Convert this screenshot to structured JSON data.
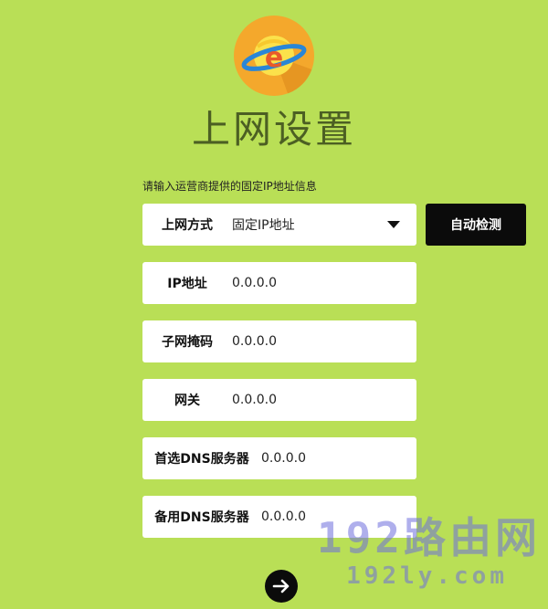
{
  "header": {
    "logo_icon": "ie-planet-icon",
    "title": "上网设置"
  },
  "form": {
    "hint": "请输入运营商提供的固定IP地址信息",
    "connection_type": {
      "label": "上网方式",
      "value": "固定IP地址"
    },
    "ip_address": {
      "label": "IP地址",
      "value": "0.0.0.0"
    },
    "subnet_mask": {
      "label": "子网掩码",
      "value": "0.0.0.0"
    },
    "gateway": {
      "label": "网关",
      "value": "0.0.0.0"
    },
    "primary_dns": {
      "label": "首选DNS服务器",
      "value": "0.0.0.0"
    },
    "secondary_dns": {
      "label": "备用DNS服务器",
      "value": "0.0.0.0"
    }
  },
  "buttons": {
    "auto_detect": "自动检测",
    "next_icon": "arrow-right-icon"
  },
  "watermark": {
    "line1": "192路由网",
    "line2": "192ly.com"
  },
  "colors": {
    "background": "#b9df56",
    "title": "#4c5f23",
    "logo": "#f4a82c",
    "button": "#0b0b0b"
  }
}
